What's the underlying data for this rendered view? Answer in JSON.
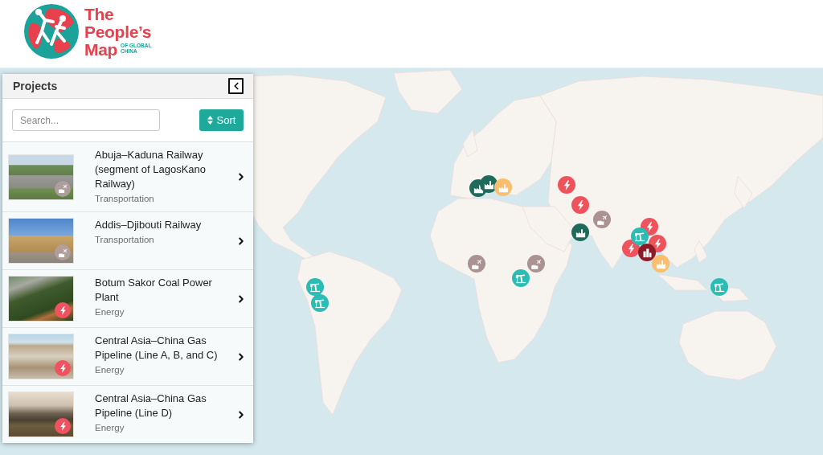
{
  "header": {
    "logo": {
      "title_lines": [
        "The",
        "People’s",
        "Map"
      ],
      "tagline_lines": [
        "OF GLOBAL",
        "CHINA"
      ]
    }
  },
  "map": {
    "markers": [
      {
        "kind": "factory",
        "color": "#1e6b5c"
      },
      {
        "kind": "factory",
        "color": "#1e6b5c"
      },
      {
        "kind": "factory",
        "color": "#fbbd6e"
      },
      {
        "kind": "bolt",
        "color": "#f0525c"
      },
      {
        "kind": "bolt",
        "color": "#f0525c"
      },
      {
        "kind": "plane",
        "color": "#a99290"
      },
      {
        "kind": "factory",
        "color": "#1e6b5c"
      },
      {
        "kind": "bolt",
        "color": "#f0525c"
      },
      {
        "kind": "bolt",
        "color": "#f0525c"
      },
      {
        "kind": "bolt",
        "color": "#f0525c"
      },
      {
        "kind": "pumpjack",
        "color": "#2bbcb3"
      },
      {
        "kind": "towers",
        "color": "#8c1b25"
      },
      {
        "kind": "factory",
        "color": "#fbbd6e"
      },
      {
        "kind": "plane",
        "color": "#a99290"
      },
      {
        "kind": "plane",
        "color": "#a99290"
      },
      {
        "kind": "pumpjack",
        "color": "#2bbcb3"
      },
      {
        "kind": "pumpjack",
        "color": "#2bbcb3"
      },
      {
        "kind": "pumpjack",
        "color": "#2bbcb3"
      },
      {
        "kind": "pumpjack",
        "color": "#2bbcb3"
      }
    ]
  },
  "panel": {
    "title": "Projects",
    "search": {
      "placeholder": "Search..."
    },
    "sort_button": "Sort",
    "items": [
      {
        "title": "Abuja–Kaduna Railway (segment of LagosKano Railway)",
        "category": "Transportation",
        "kind": "transport"
      },
      {
        "title": "Addis–Djibouti Railway",
        "category": "Transportation",
        "kind": "transport"
      },
      {
        "title": "Botum Sakor Coal Power Plant",
        "category": "Energy",
        "kind": "energy"
      },
      {
        "title": "Central Asia–China Gas Pipeline (Line A, B, and C)",
        "category": "Energy",
        "kind": "energy"
      },
      {
        "title": "Central Asia–China Gas Pipeline (Line D)",
        "category": "Energy",
        "kind": "energy"
      }
    ]
  }
}
